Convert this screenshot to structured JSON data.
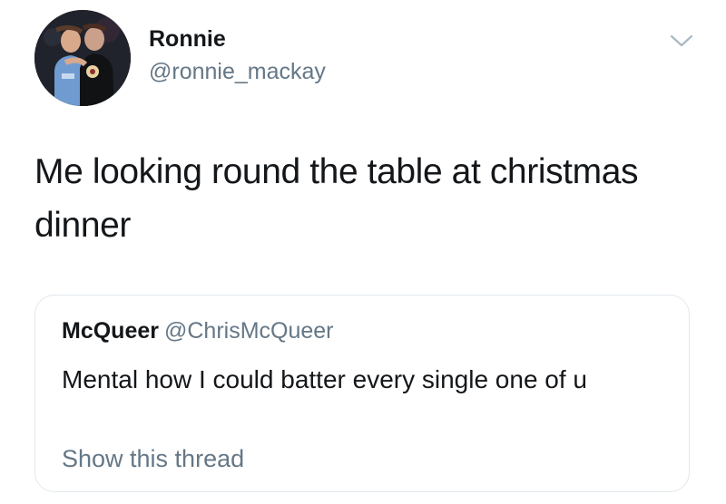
{
  "tweet": {
    "author": {
      "display_name": "Ronnie",
      "handle": "@ronnie_mackay",
      "avatar": "profile-photo-two-people"
    },
    "menu_icon": "chevron-down-icon",
    "text": "Me looking round the table at christmas dinner",
    "quoted_tweet": {
      "display_name": "McQueer",
      "handle": "@ChrisMcQueer",
      "text": "Mental how I could batter every single one of u",
      "show_thread_label": "Show this thread"
    }
  },
  "colors": {
    "primary_text": "#14171a",
    "secondary_text": "#657786",
    "border": "#e1e8ed",
    "background": "#ffffff"
  }
}
